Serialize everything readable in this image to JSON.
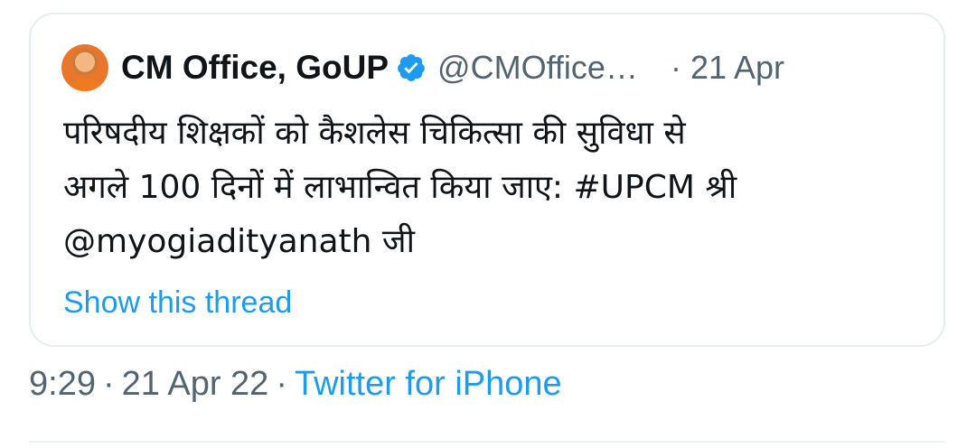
{
  "quoted_tweet": {
    "display_name": "CM Office, GoUP",
    "handle": "@CMOffice…",
    "date": "21 Apr",
    "text_lines": [
      "परिषदीय शिक्षकों को कैशलेस चिकित्सा की सुविधा से",
      "अगले 100 दिनों में लाभान्वित किया जाए: #UPCM श्री",
      "@myogiadityanath जी"
    ],
    "show_thread": "Show this thread"
  },
  "tweet_meta": {
    "time": "9:29",
    "date": "21 Apr 22",
    "source": "Twitter for iPhone"
  },
  "colors": {
    "link": "#1d9bf0",
    "muted": "#536471",
    "verified": "#1d9bf0"
  },
  "icons": {
    "verified": "verified-badge-icon",
    "avatar": "profile-avatar"
  }
}
